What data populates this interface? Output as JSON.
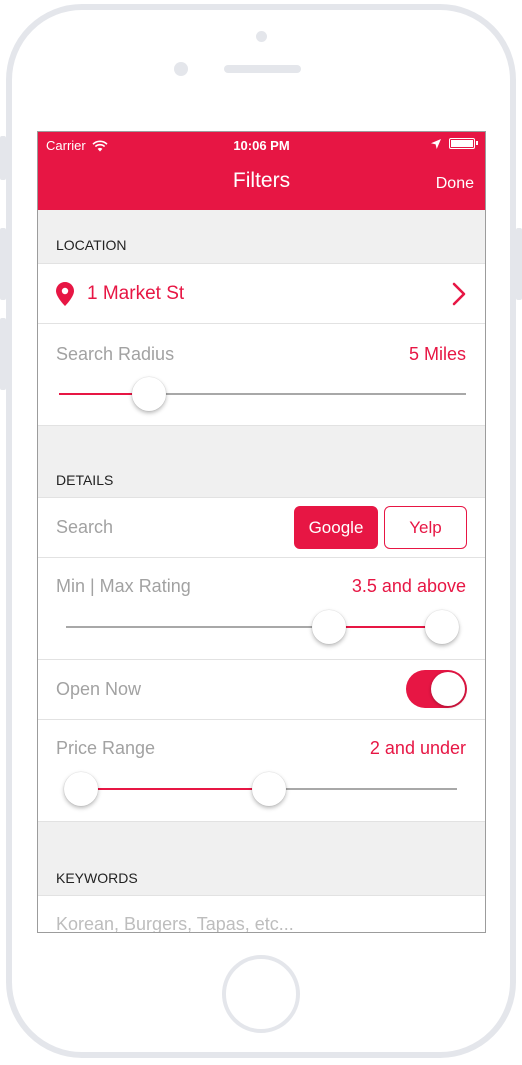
{
  "status_bar": {
    "carrier": "Carrier",
    "time": "10:06 PM"
  },
  "nav": {
    "title": "Filters",
    "done": "Done"
  },
  "location": {
    "header": "LOCATION",
    "address": "1 Market St",
    "radius_label": "Search Radius",
    "radius_value": "5 Miles",
    "radius_fraction": 0.22
  },
  "details": {
    "header": "DETAILS",
    "search_label": "Search",
    "search_options": [
      "Google",
      "Yelp"
    ],
    "search_selected": "Google",
    "rating_label": "Min | Max Rating",
    "rating_value": "3.5 and above",
    "rating_range": [
      0.7,
      1.0
    ],
    "open_now_label": "Open Now",
    "open_now": true,
    "price_label": "Price Range",
    "price_value": "2 and under",
    "price_range": [
      0.0,
      0.5
    ]
  },
  "keywords": {
    "header": "KEYWORDS",
    "placeholder": "Korean, Burgers, Tapas, etc..."
  },
  "colors": {
    "accent": "#e71644"
  }
}
